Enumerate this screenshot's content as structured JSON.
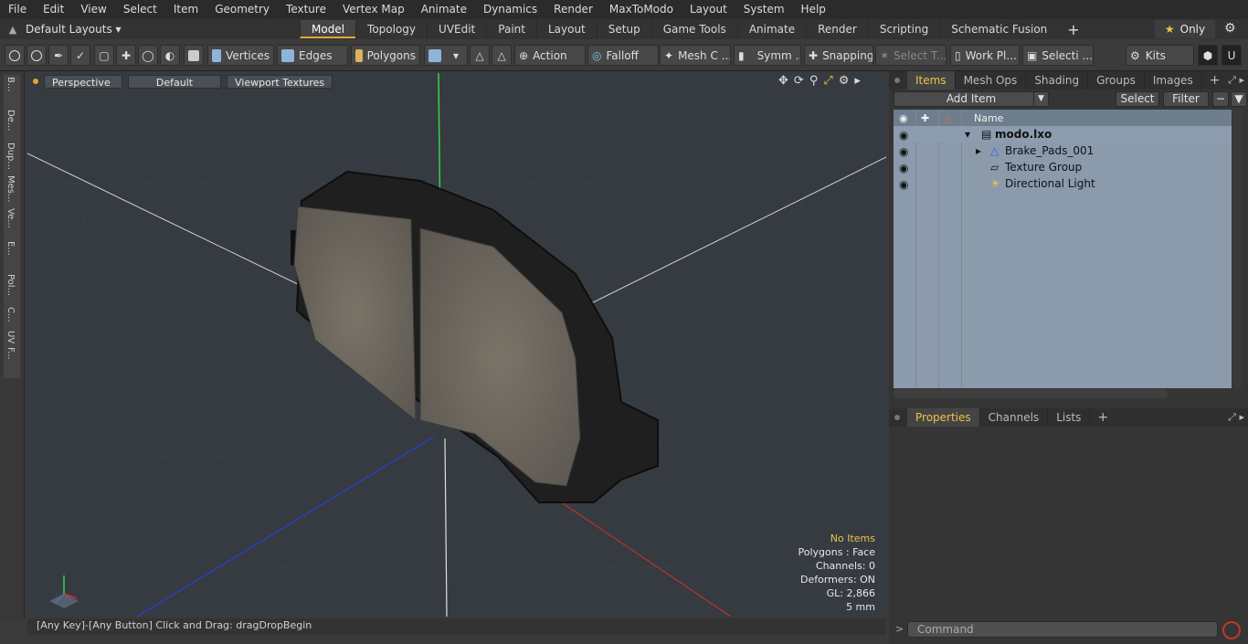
{
  "menu": [
    "File",
    "Edit",
    "View",
    "Select",
    "Item",
    "Geometry",
    "Texture",
    "Vertex Map",
    "Animate",
    "Dynamics",
    "Render",
    "MaxToModo",
    "Layout",
    "System",
    "Help"
  ],
  "layouts_label": "Default Layouts ▾",
  "mode_tabs": [
    "Model",
    "Topology",
    "UVEdit",
    "Paint",
    "Layout",
    "Setup",
    "Game Tools",
    "Animate",
    "Render",
    "Scripting",
    "Schematic Fusion"
  ],
  "only_label": "Only",
  "toolbar": {
    "vertices": "Vertices",
    "edges": "Edges",
    "polygons": "Polygons",
    "action": "Action",
    "falloff": "Falloff",
    "mesh_c": "Mesh C ...",
    "symm": "Symm ...",
    "snapping": "Snapping",
    "select_t": "Select T...",
    "work_pl": "Work Pl...",
    "selecti": "Selecti ...",
    "kits": "Kits"
  },
  "left_tabs": [
    "B...",
    "De...",
    "Dup...",
    "Mes...",
    "Ve...",
    "E...",
    "Pol...",
    "C...",
    "UV",
    "F..."
  ],
  "viewport": {
    "perspective": "Perspective",
    "default": "Default",
    "textures": "Viewport Textures"
  },
  "hud": {
    "no_items": "No Items",
    "polygons": "Polygons : Face",
    "channels": "Channels: 0",
    "deformers": "Deformers: ON",
    "gl": "GL: 2,866",
    "scale": "5 mm"
  },
  "status_text": "[Any Key]-[Any Button] Click and Drag:  dragDropBegin",
  "items_panel": {
    "tabs": [
      "Items",
      "Mesh Ops",
      "Shading",
      "Groups",
      "Images"
    ],
    "add_item": "Add Item",
    "select": "Select",
    "filter": "Filter",
    "name_header": "Name",
    "rows": [
      {
        "label": "modo.lxo"
      },
      {
        "label": "Brake_Pads_001"
      },
      {
        "label": "Texture Group"
      },
      {
        "label": "Directional Light"
      }
    ]
  },
  "properties_tabs": [
    "Properties",
    "Channels",
    "Lists"
  ],
  "command_placeholder": "Command",
  "colors": {
    "accent": "#f0c24a",
    "tree_bg": "#8b9bac",
    "viewport_bg": "#353b40"
  }
}
